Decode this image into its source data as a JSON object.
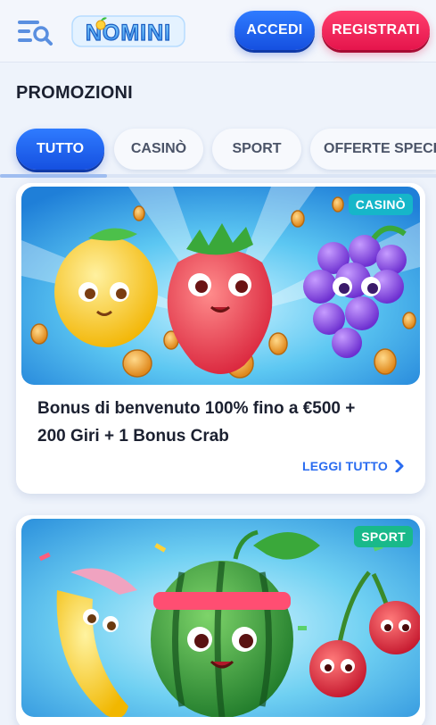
{
  "header": {
    "logo_text": "NOMINI",
    "login_label": "ACCEDI",
    "register_label": "REGISTRATI"
  },
  "page": {
    "title": "PROMOZIONI"
  },
  "tabs": [
    {
      "label": "TUTTO",
      "active": true
    },
    {
      "label": "CASINÒ",
      "active": false
    },
    {
      "label": "SPORT",
      "active": false
    },
    {
      "label": "OFFERTE SPECIALI",
      "active": false
    }
  ],
  "promos": [
    {
      "badge": "CASINÒ",
      "title": "Bonus di benvenuto 100% fino a €500 + 200 Giri + 1 Bonus Crab",
      "cta": "LEGGI TUTTO",
      "image_icon": "fruit-trio-illustration"
    },
    {
      "badge": "SPORT",
      "image_icon": "sport-fruits-illustration"
    }
  ],
  "colors": {
    "primary": "#1e5ff0",
    "accent": "#ef2155",
    "casino_badge": "#16b6c9",
    "sport_badge": "#19b98a",
    "background": "#eef3fb"
  }
}
